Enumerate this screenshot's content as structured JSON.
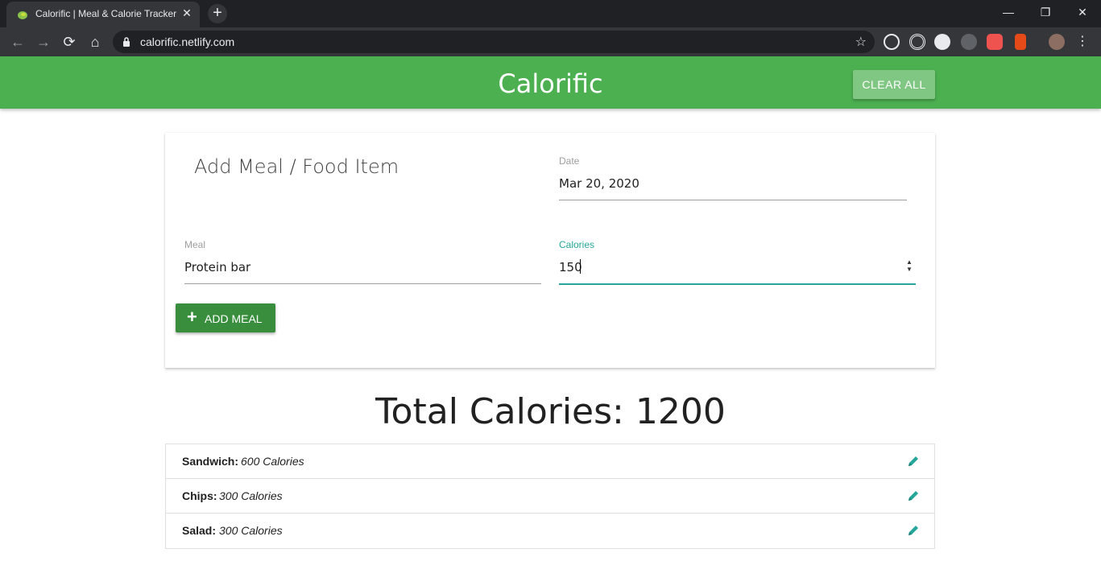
{
  "browser": {
    "tab_title": "Calorific | Meal & Calorie Tracker",
    "tab_close": "✕",
    "new_tab": "+",
    "url": "calorific.netlify.com",
    "window_controls": [
      "—",
      "❐",
      "✕"
    ],
    "nav": {
      "back": "←",
      "forward": "→",
      "reload": "⟳",
      "home": "⌂"
    },
    "star": "☆"
  },
  "header": {
    "brand": "Calorific",
    "clear_all": "CLEAR ALL"
  },
  "form": {
    "title": "Add Meal / Food Item",
    "date_label": "Date",
    "date_value": "Mar 20, 2020",
    "meal_label": "Meal",
    "meal_value": "Protein bar",
    "calories_label": "Calories",
    "calories_value": "150",
    "add_button": "ADD MEAL",
    "add_icon": "+"
  },
  "total": "Total Calories: 1200",
  "items": [
    {
      "name": "Sandwich:",
      "calories": "600 Calories"
    },
    {
      "name": "Chips:",
      "calories": "300 Calories"
    },
    {
      "name": "Salad:",
      "calories": "300 Calories"
    }
  ],
  "colors": {
    "primary": "#4caf50",
    "accent": "#26a69a",
    "button": "#388e3c"
  }
}
